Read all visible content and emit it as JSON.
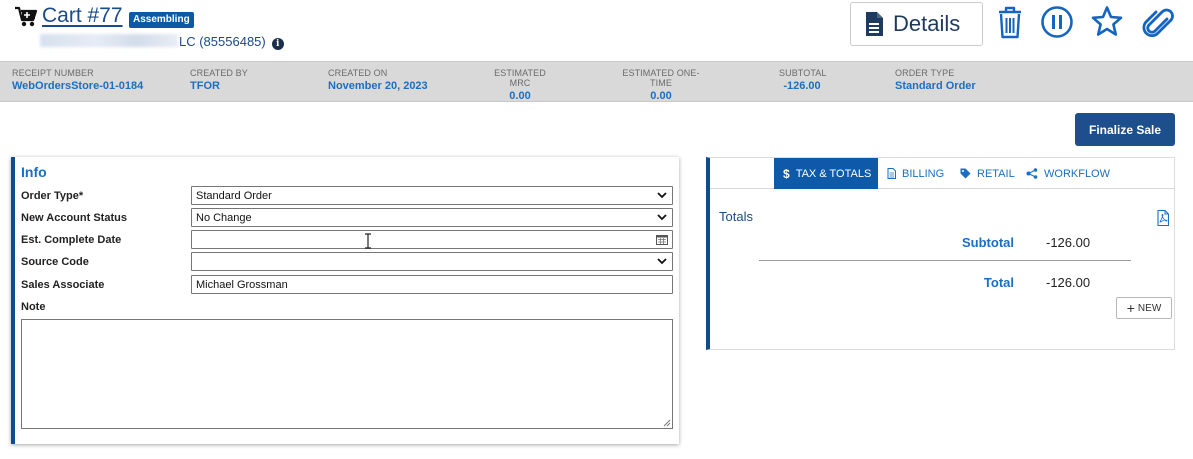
{
  "header": {
    "cart_title": "Cart #77",
    "status_badge": "Assembling",
    "account_suffix": "LC (85556485)",
    "details_label": "Details"
  },
  "summary": [
    {
      "label": "RECEIPT NUMBER",
      "value": "WebOrdersStore-01-0184"
    },
    {
      "label": "CREATED BY",
      "value": "TFOR"
    },
    {
      "label": "CREATED ON",
      "value": "November 20, 2023"
    },
    {
      "label": "ESTIMATED MRC",
      "value": "0.00"
    },
    {
      "label": "ESTIMATED ONE-TIME",
      "value": "0.00"
    },
    {
      "label": "SUBTOTAL",
      "value": "-126.00"
    },
    {
      "label": "ORDER TYPE",
      "value": "Standard Order"
    }
  ],
  "actions": {
    "finalize_label": "Finalize Sale"
  },
  "info": {
    "title": "Info",
    "order_type_label": "Order Type*",
    "order_type_value": "Standard Order",
    "account_status_label": "New Account Status",
    "account_status_value": "No Change",
    "complete_date_label": "Est. Complete Date",
    "complete_date_value": "",
    "source_code_label": "Source Code",
    "source_code_value": "",
    "sales_associate_label": "Sales Associate",
    "sales_associate_value": "Michael Grossman",
    "note_label": "Note",
    "note_value": ""
  },
  "tabs": [
    {
      "label": "TAX & TOTALS",
      "icon": "dollar-icon",
      "active": true
    },
    {
      "label": "BILLING",
      "icon": "document-icon",
      "active": false
    },
    {
      "label": "RETAIL",
      "icon": "tag-icon",
      "active": false
    },
    {
      "label": "WORKFLOW",
      "icon": "workflow-icon",
      "active": false
    }
  ],
  "totals": {
    "section_label": "Totals",
    "subtotal_label": "Subtotal",
    "subtotal_value": "-126.00",
    "total_label": "Total",
    "total_value": "-126.00",
    "new_label": "NEW"
  },
  "colors": {
    "primary": "#1c4f8c",
    "accent": "#1a6fc4",
    "icon_blue": "#1565c0"
  }
}
